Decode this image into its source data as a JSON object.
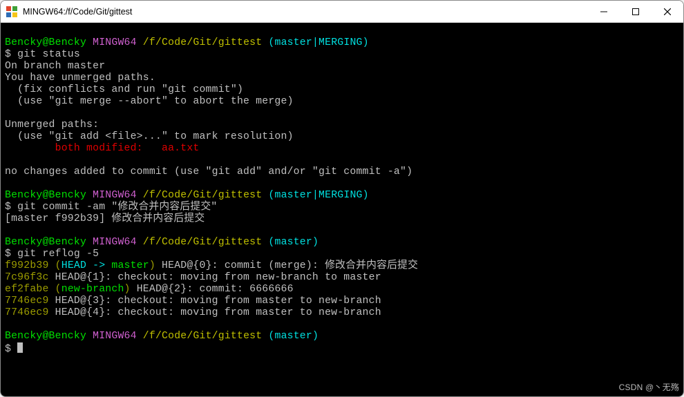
{
  "window": {
    "title": "MINGW64:/f/Code/Git/gittest"
  },
  "prompt": {
    "user_host": "Bencky@Bencky",
    "env": "MINGW64",
    "path": "/f/Code/Git/gittest",
    "branchMerging": "(master|MERGING)",
    "branchMaster": "(master)",
    "ps": "$ "
  },
  "cmd": {
    "status": "git status",
    "commit": "git commit -am \"修改合并内容后提交\"",
    "reflog": "git reflog -5"
  },
  "out": {
    "status_l1": "On branch master",
    "status_l2": "You have unmerged paths.",
    "status_l3": "  (fix conflicts and run \"git commit\")",
    "status_l4": "  (use \"git merge --abort\" to abort the merge)",
    "status_l5": "Unmerged paths:",
    "status_l6": "  (use \"git add <file>...\" to mark resolution)",
    "status_conflict_label": "        both modified:   ",
    "status_conflict_file": "aa.txt",
    "status_l8": "no changes added to commit (use \"git add\" and/or \"git commit -a\")",
    "commit_l1": "[master f992b39] 修改合并内容后提交",
    "ref0_hash": "f992b39",
    "ref0_head": " (",
    "ref0_headcyan": "HEAD -> ",
    "ref0_headgreen": "master",
    "ref0_headclose": ")",
    "ref0_rest": " HEAD@{0}: commit (merge): 修改合并内容后提交",
    "ref1_hash": "7c96f3c",
    "ref1_rest": " HEAD@{1}: checkout: moving from new-branch to master",
    "ref2_hash": "ef2fabe",
    "ref2_br_open": " (",
    "ref2_br": "new-branch",
    "ref2_br_close": ")",
    "ref2_rest": " HEAD@{2}: commit: 6666666",
    "ref3_hash": "7746ec9",
    "ref3_rest": " HEAD@{3}: checkout: moving from master to new-branch",
    "ref4_hash": "7746ec9",
    "ref4_rest": " HEAD@{4}: checkout: moving from master to new-branch"
  },
  "watermark": "CSDN @丶无殇"
}
